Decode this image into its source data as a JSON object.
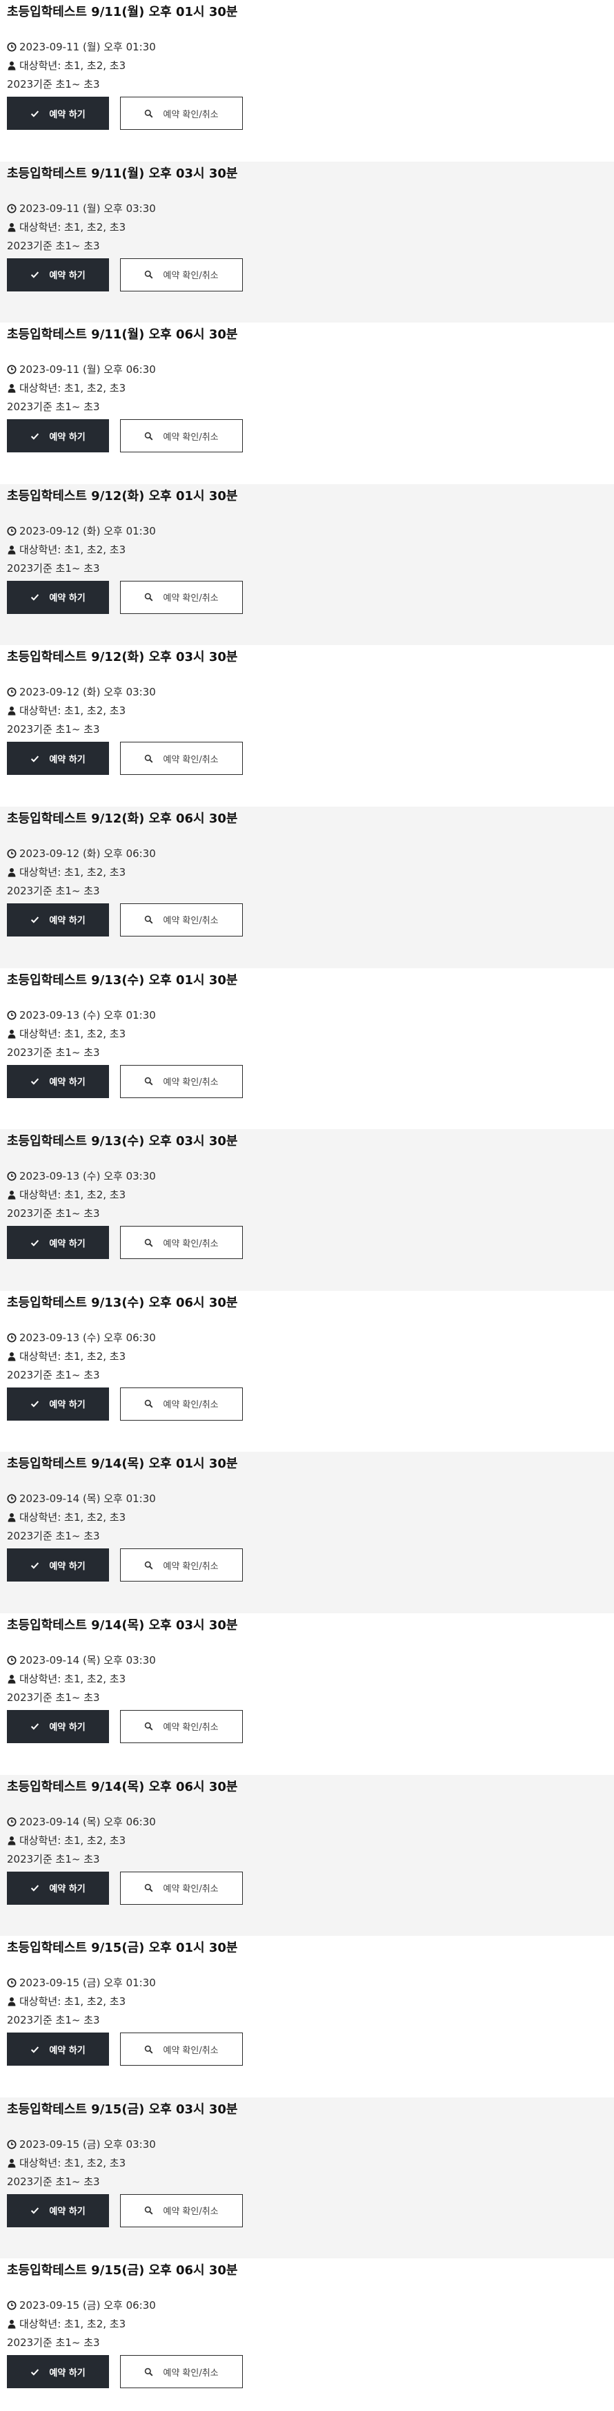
{
  "buttons": {
    "reserve_label": "예약 하기",
    "check_label": "예약 확인/취소",
    "reserve_icon": "check-icon",
    "check_icon": "search-icon"
  },
  "meta_icons": {
    "datetime": "clock-icon",
    "grade": "user-icon"
  },
  "sessions": [
    {
      "title": "초등입학테스트 9/11(월)  오후 01시 30분",
      "datetime": "2023-09-11 (월) 오후 01:30",
      "grades": "대상학년: 초1, 초2, 초3",
      "basis": "2023기준 초1~ 초3"
    },
    {
      "title": "초등입학테스트 9/11(월)  오후 03시 30분",
      "datetime": "2023-09-11 (월) 오후 03:30",
      "grades": "대상학년: 초1, 초2, 초3",
      "basis": "2023기준 초1~ 초3"
    },
    {
      "title": "초등입학테스트 9/11(월)  오후 06시 30분",
      "datetime": "2023-09-11 (월) 오후 06:30",
      "grades": "대상학년: 초1, 초2, 초3",
      "basis": "2023기준 초1~ 초3"
    },
    {
      "title": "초등입학테스트 9/12(화)  오후 01시 30분",
      "datetime": "2023-09-12 (화) 오후 01:30",
      "grades": "대상학년: 초1, 초2, 초3",
      "basis": "2023기준 초1~ 초3"
    },
    {
      "title": "초등입학테스트 9/12(화)  오후 03시 30분",
      "datetime": "2023-09-12 (화) 오후 03:30",
      "grades": "대상학년: 초1, 초2, 초3",
      "basis": "2023기준 초1~ 초3"
    },
    {
      "title": "초등입학테스트 9/12(화)  오후 06시 30분",
      "datetime": "2023-09-12 (화) 오후 06:30",
      "grades": "대상학년: 초1, 초2, 초3",
      "basis": "2023기준 초1~ 초3"
    },
    {
      "title": "초등입학테스트 9/13(수)  오후 01시 30분",
      "datetime": "2023-09-13 (수) 오후 01:30",
      "grades": "대상학년: 초1, 초2, 초3",
      "basis": "2023기준 초1~ 초3"
    },
    {
      "title": "초등입학테스트 9/13(수)  오후 03시 30분",
      "datetime": "2023-09-13 (수) 오후 03:30",
      "grades": "대상학년: 초1, 초2, 초3",
      "basis": "2023기준 초1~ 초3"
    },
    {
      "title": "초등입학테스트 9/13(수)  오후 06시 30분",
      "datetime": "2023-09-13 (수) 오후 06:30",
      "grades": "대상학년: 초1, 초2, 초3",
      "basis": "2023기준 초1~ 초3"
    },
    {
      "title": "초등입학테스트 9/14(목)  오후 01시 30분",
      "datetime": "2023-09-14 (목) 오후 01:30",
      "grades": "대상학년: 초1, 초2, 초3",
      "basis": "2023기준 초1~ 초3"
    },
    {
      "title": "초등입학테스트 9/14(목)  오후 03시 30분",
      "datetime": "2023-09-14 (목) 오후 03:30",
      "grades": "대상학년: 초1, 초2, 초3",
      "basis": "2023기준 초1~ 초3"
    },
    {
      "title": "초등입학테스트 9/14(목)  오후 06시 30분",
      "datetime": "2023-09-14 (목) 오후 06:30",
      "grades": "대상학년: 초1, 초2, 초3",
      "basis": "2023기준 초1~ 초3"
    },
    {
      "title": "초등입학테스트 9/15(금)  오후 01시 30분",
      "datetime": "2023-09-15 (금) 오후 01:30",
      "grades": "대상학년: 초1, 초2, 초3",
      "basis": "2023기준 초1~ 초3"
    },
    {
      "title": "초등입학테스트 9/15(금)  오후 03시 30분",
      "datetime": "2023-09-15 (금) 오후 03:30",
      "grades": "대상학년: 초1, 초2, 초3",
      "basis": "2023기준 초1~ 초3"
    },
    {
      "title": "초등입학테스트 9/15(금)  오후 06시 30분",
      "datetime": "2023-09-15 (금) 오후 06:30",
      "grades": "대상학년: 초1, 초2, 초3",
      "basis": "2023기준 초1~ 초3"
    }
  ]
}
